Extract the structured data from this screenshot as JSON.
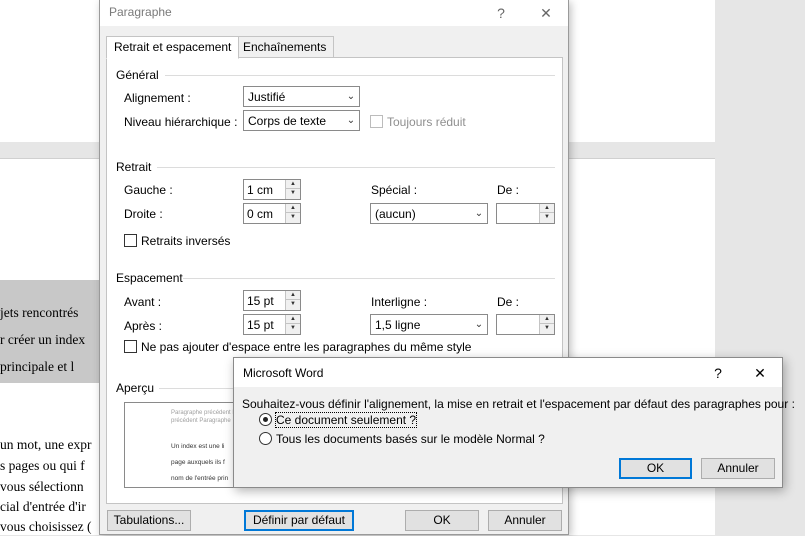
{
  "document": {
    "lines": [
      "jets  rencontrés",
      "r créer un index",
      "  principale  et  l",
      "un mot, une expr",
      "s pages ou qui f",
      " vous sélectionn",
      "cial d'entrée d'ir",
      "vous choisissez ("
    ]
  },
  "paragraph_dialog": {
    "title": "Paragraphe",
    "help": "?",
    "close": "✕",
    "tabs": [
      {
        "label": "Retrait et espacement"
      },
      {
        "label": "Enchaînements"
      }
    ],
    "general": {
      "heading": "Général",
      "alignment_label": "Alignement :",
      "alignment_value": "Justifié",
      "level_label": "Niveau hiérarchique :",
      "level_value": "Corps de texte",
      "collapsed_label": "Toujours réduit"
    },
    "indent": {
      "heading": "Retrait",
      "left_label": "Gauche :",
      "left_value": "1 cm",
      "right_label": "Droite :",
      "right_value": "0 cm",
      "special_label": "Spécial :",
      "special_value": "(aucun)",
      "by_label": "De :",
      "by_value": "",
      "mirror_label": "Retraits inversés"
    },
    "spacing": {
      "heading": "Espacement",
      "before_label": "Avant :",
      "before_value": "15 pt",
      "after_label": "Après :",
      "after_value": "15 pt",
      "line_label": "Interligne :",
      "line_value": "1,5 ligne",
      "at_label": "De :",
      "at_value": "",
      "no_space_label": "Ne pas ajouter d'espace entre les paragraphes du même style"
    },
    "preview": {
      "heading": "Aperçu",
      "grey_1": "Paragraphe précédent Paragraphe précédent Paragraphe",
      "grey_2": "précédent Paragraphe",
      "text_1": "Un index est une li",
      "text_2": "page auxquels ils f",
      "text_3": "nom de l'entrée prin"
    },
    "buttons": {
      "tabs": "Tabulations...",
      "default": "Définir par défaut",
      "ok": "OK",
      "cancel": "Annuler"
    }
  },
  "word_prompt": {
    "title": "Microsoft Word",
    "help": "?",
    "close": "✕",
    "question": "Souhaitez-vous définir l'alignement, la mise en retrait et l'espacement par défaut des paragraphes pour :",
    "option_1": "Ce document seulement ?",
    "option_2": "Tous les documents basés sur le modèle Normal ?",
    "selected_option": 1,
    "ok": "OK",
    "cancel": "Annuler"
  }
}
